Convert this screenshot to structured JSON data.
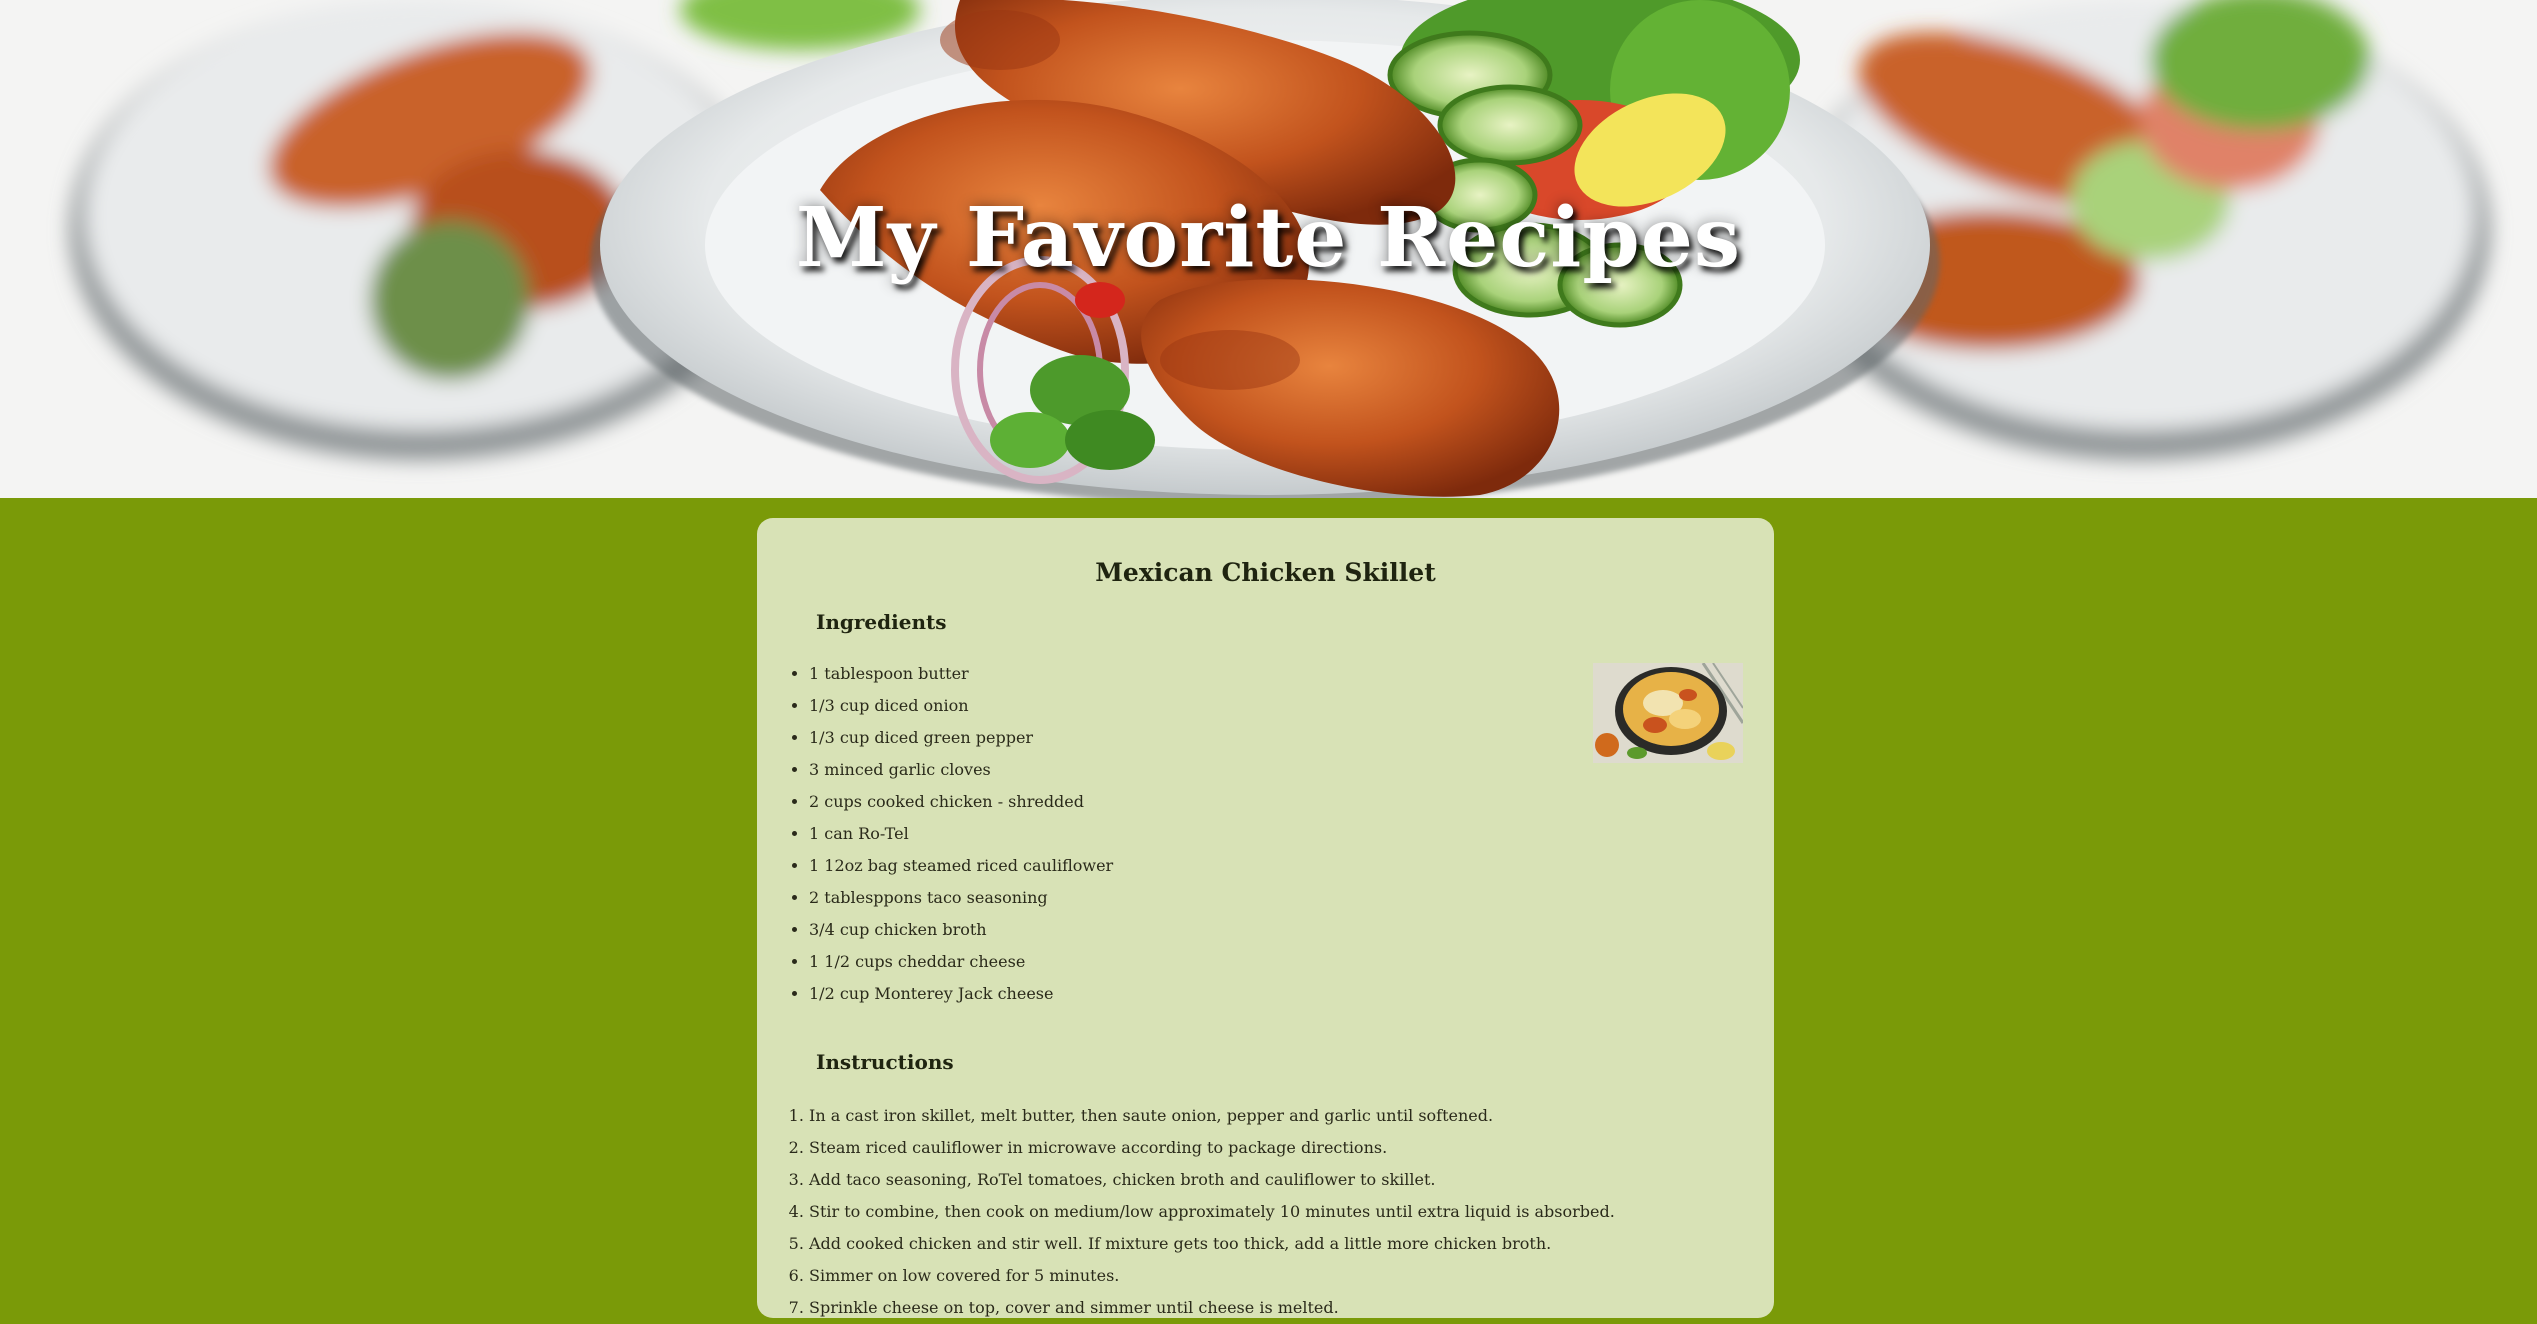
{
  "header": {
    "title": "My Favorite Recipes"
  },
  "recipe": {
    "title": "Mexican Chicken Skillet",
    "ingredients_heading": "Ingredients",
    "ingredients": [
      "1 tablespoon butter",
      "1/3 cup diced onion",
      "1/3 cup diced green pepper",
      "3 minced garlic cloves",
      "2 cups cooked chicken - shredded",
      "1 can Ro-Tel",
      "1 12oz bag steamed riced cauliflower",
      "2 tablesppons taco seasoning",
      "3/4 cup chicken broth",
      "1 1/2 cups cheddar cheese",
      "1/2 cup Monterey Jack cheese"
    ],
    "instructions_heading": "Instructions",
    "instructions": [
      "In a cast iron skillet, melt butter, then saute onion, pepper and garlic until softened.",
      "Steam riced cauliflower in microwave according to package directions.",
      "Add taco seasoning, RoTel tomatoes, chicken broth and cauliflower to skillet.",
      "Stir to combine, then cook on medium/low approximately 10 minutes until extra liquid is absorbed.",
      "Add cooked chicken and stir well. If mixture gets too thick, add a little more chicken broth.",
      "Simmer on low covered for 5 minutes.",
      "Sprinkle cheese on top, cover and simmer until cheese is melted."
    ]
  },
  "colors": {
    "page_background": "#7a9a08",
    "card_background": "#d8e2b6",
    "hero_background": "#f4f4f3"
  }
}
